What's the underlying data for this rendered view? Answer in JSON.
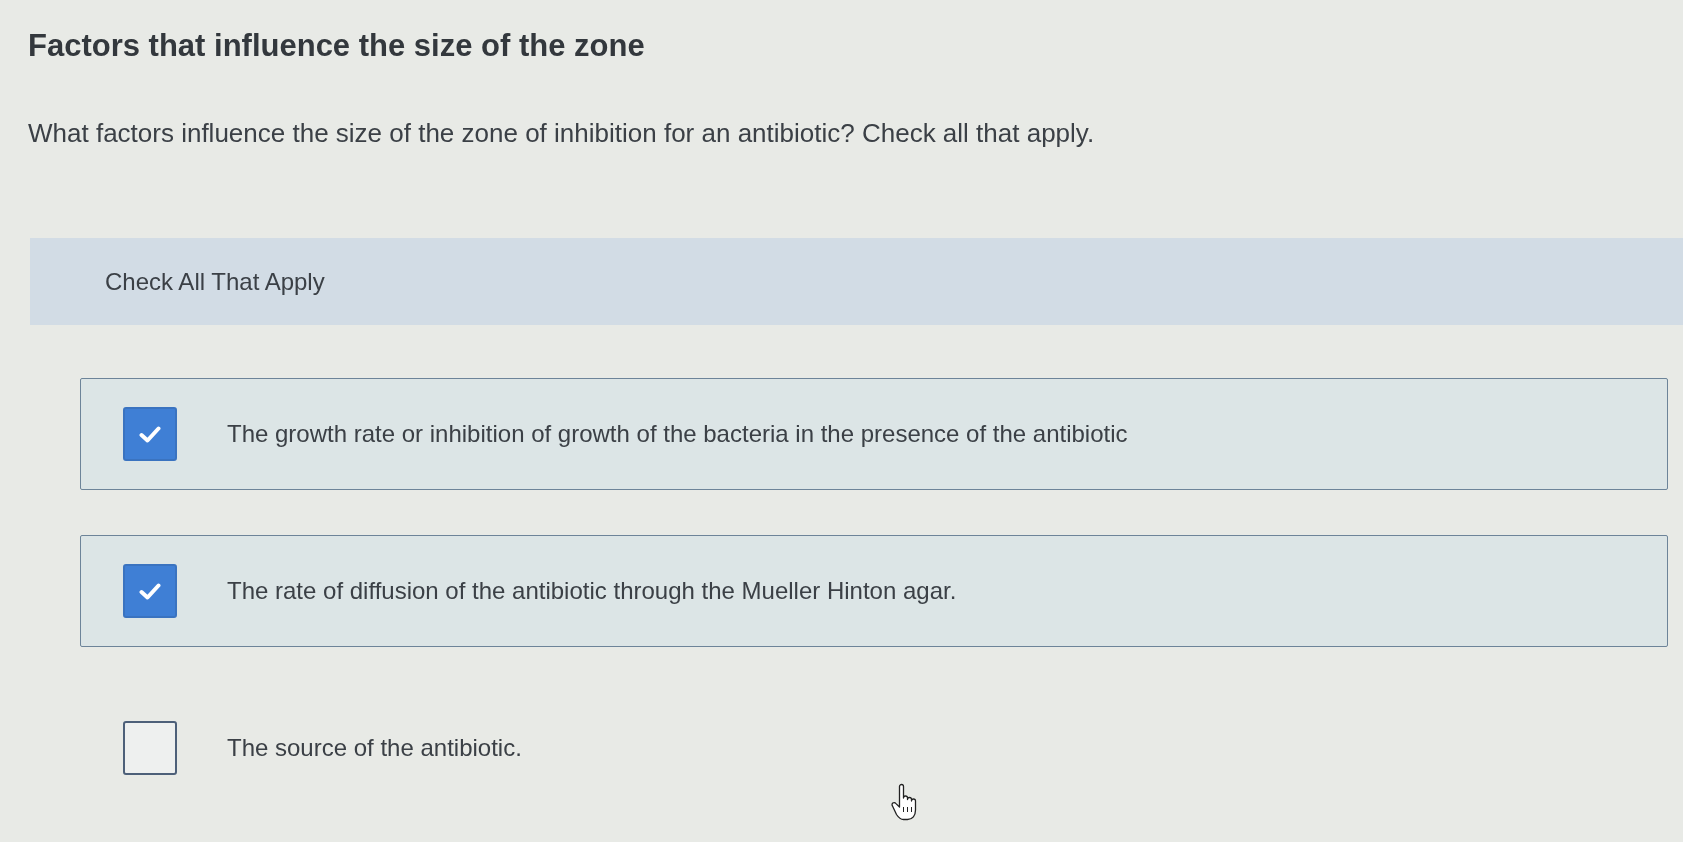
{
  "heading": "Factors that influence the size of the zone",
  "question": "What factors influence the size of the zone of inhibition for an antibiotic? Check all that apply.",
  "instruction": "Check All That Apply",
  "options": [
    {
      "label": "The growth rate or inhibition of growth of the bacteria in the presence of the antibiotic",
      "checked": true
    },
    {
      "label": "The rate of diffusion of the antibiotic through the Mueller Hinton agar.",
      "checked": true
    },
    {
      "label": "The source of the antibiotic.",
      "checked": false
    }
  ]
}
